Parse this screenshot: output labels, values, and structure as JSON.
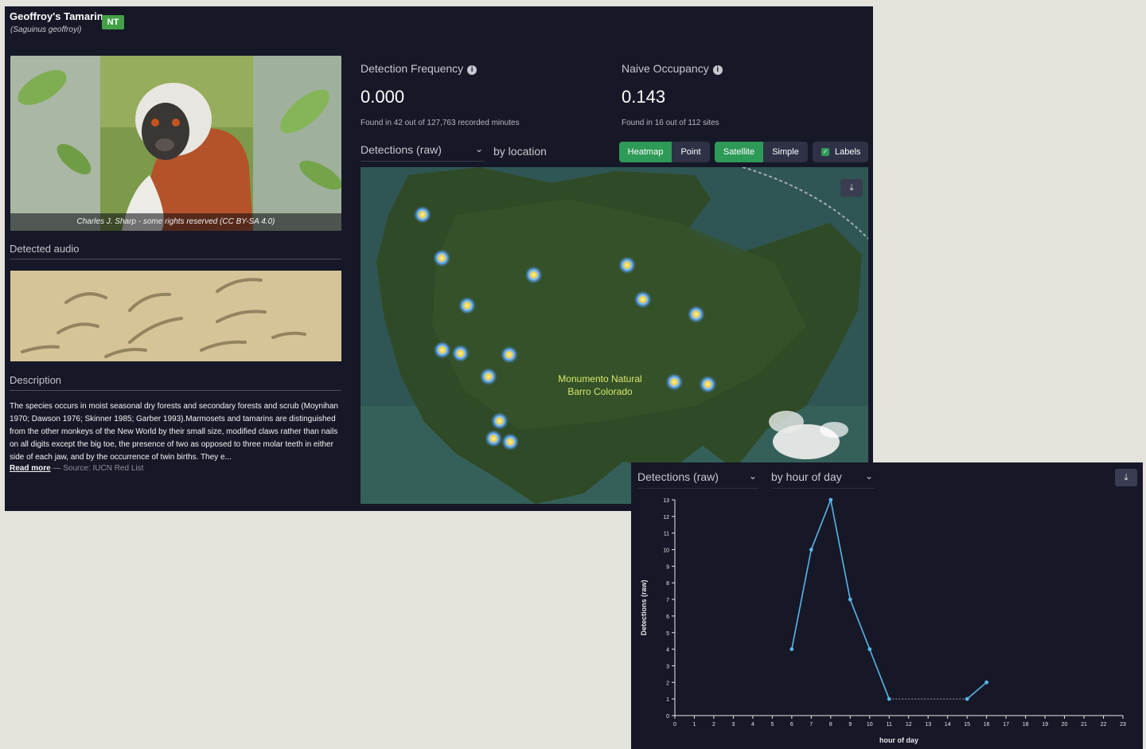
{
  "species": {
    "common_name": "Geoffroy's Tamarin",
    "scientific_name": "(Saguinus geoffroyi)",
    "iucn_badge": "NT",
    "photo_credit": "Charles J. Sharp - some rights reserved (CC BY-SA 4.0)"
  },
  "audio": {
    "title": "Detected audio"
  },
  "description": {
    "title": "Description",
    "text": "The species occurs in moist seasonal dry forests and secondary forests and scrub (Moynihan 1970; Dawson 1976; Skinner 1985; Garber 1993).Marmosets and tamarins are distinguished from the other monkeys of the New World by their small size, modified claws rather than nails on all digits except the big toe, the presence of two as opposed to three molar teeth in either side of each jaw, and by the occurrence of twin births. They e...",
    "read_more": "Read more",
    "source": "— Source: IUCN Red List"
  },
  "metrics": {
    "detection_frequency": {
      "label": "Detection Frequency",
      "value": "0.000",
      "note": "Found in 42 out of 127,763 recorded minutes"
    },
    "naive_occupancy": {
      "label": "Naive Occupancy",
      "value": "0.143",
      "note": "Found in 16 out of 112 sites"
    }
  },
  "map_controls": {
    "measure_select": "Detections (raw)",
    "by_label": "by location",
    "heatmap": "Heatmap",
    "point": "Point",
    "satellite": "Satellite",
    "simple": "Simple",
    "labels": "Labels",
    "labels_checked": true,
    "active_style": "Heatmap",
    "active_base": "Satellite"
  },
  "map": {
    "place_label_line1": "Monumento Natural",
    "place_label_line2": "Barro Colorado",
    "download_icon": "download-icon",
    "sites": [
      {
        "lon_rel": 0.122,
        "lat_rel": 0.141
      },
      {
        "lon_rel": 0.16,
        "lat_rel": 0.27
      },
      {
        "lon_rel": 0.341,
        "lat_rel": 0.32
      },
      {
        "lon_rel": 0.525,
        "lat_rel": 0.291
      },
      {
        "lon_rel": 0.21,
        "lat_rel": 0.411
      },
      {
        "lon_rel": 0.556,
        "lat_rel": 0.393
      },
      {
        "lon_rel": 0.661,
        "lat_rel": 0.437
      },
      {
        "lon_rel": 0.161,
        "lat_rel": 0.543
      },
      {
        "lon_rel": 0.197,
        "lat_rel": 0.553
      },
      {
        "lon_rel": 0.293,
        "lat_rel": 0.557
      },
      {
        "lon_rel": 0.252,
        "lat_rel": 0.622
      },
      {
        "lon_rel": 0.618,
        "lat_rel": 0.638
      },
      {
        "lon_rel": 0.684,
        "lat_rel": 0.645
      },
      {
        "lon_rel": 0.274,
        "lat_rel": 0.754
      },
      {
        "lon_rel": 0.262,
        "lat_rel": 0.806
      },
      {
        "lon_rel": 0.295,
        "lat_rel": 0.816
      }
    ]
  },
  "chart_controls": {
    "measure_select": "Detections (raw)",
    "group_select": "by hour of day",
    "download_icon": "download-icon"
  },
  "chart_data": {
    "type": "line",
    "xlabel": "hour of day",
    "ylabel": "Detections (raw)",
    "xlim": [
      0,
      23
    ],
    "ylim": [
      0,
      13
    ],
    "x_ticks": [
      0,
      1,
      2,
      3,
      4,
      5,
      6,
      7,
      8,
      9,
      10,
      11,
      12,
      13,
      14,
      15,
      16,
      17,
      18,
      19,
      20,
      21,
      22,
      23
    ],
    "y_ticks": [
      0,
      1,
      2,
      3,
      4,
      5,
      6,
      7,
      8,
      9,
      10,
      11,
      12,
      13
    ],
    "series": [
      {
        "color": "#5ab4e8",
        "points": [
          {
            "x": 6,
            "y": 4
          },
          {
            "x": 7,
            "y": 10
          },
          {
            "x": 8,
            "y": 13
          },
          {
            "x": 9,
            "y": 7
          },
          {
            "x": 10,
            "y": 4
          },
          {
            "x": 11,
            "y": 1
          },
          {
            "x": 15,
            "y": 1
          },
          {
            "x": 16,
            "y": 2
          }
        ],
        "gap_after_x": 11
      }
    ]
  },
  "colors": {
    "panel_bg": "#161827",
    "accent_green": "#2e9a58",
    "badge_green": "#43a047",
    "line_blue": "#5ab4e8"
  }
}
